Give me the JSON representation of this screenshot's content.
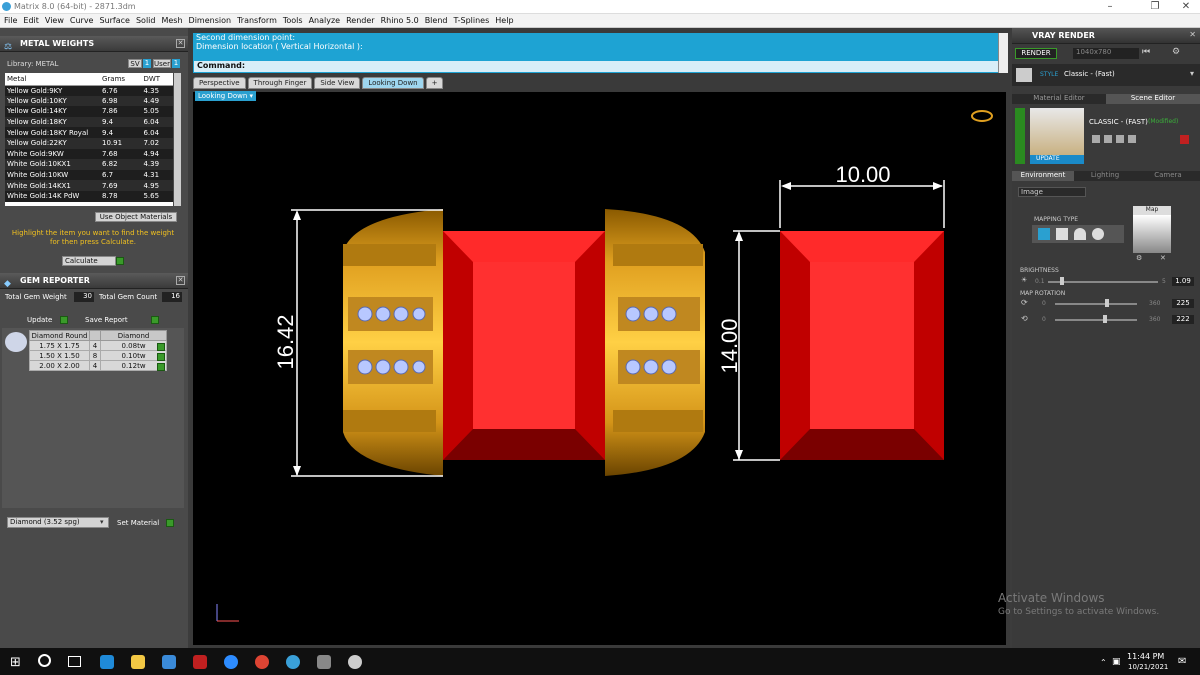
{
  "window": {
    "title": "Matrix 8.0 (64-bit) - 2871.3dm"
  },
  "menu": [
    "File",
    "Edit",
    "View",
    "Curve",
    "Surface",
    "Solid",
    "Mesh",
    "Dimension",
    "Transform",
    "Tools",
    "Analyze",
    "Render",
    "Rhino 5.0",
    "Blend",
    "T-Splines",
    "Help"
  ],
  "metal_weights": {
    "title": "METAL WEIGHTS",
    "library_label": "Library: METAL",
    "sv_label": "SV",
    "user_label": "User",
    "sv_count": "1",
    "user_count": "1",
    "columns": [
      "Metal",
      "Grams",
      "DWT"
    ],
    "rows": [
      [
        "Yellow Gold:9KY",
        "6.76",
        "4.35"
      ],
      [
        "Yellow Gold:10KY",
        "6.98",
        "4.49"
      ],
      [
        "Yellow Gold:14KY",
        "7.86",
        "5.05"
      ],
      [
        "Yellow Gold:18KY",
        "9.4",
        "6.04"
      ],
      [
        "Yellow Gold:18KY Royal",
        "9.4",
        "6.04"
      ],
      [
        "Yellow Gold:22KY",
        "10.91",
        "7.02"
      ],
      [
        "White Gold:9KW",
        "7.68",
        "4.94"
      ],
      [
        "White Gold:10KX1",
        "6.82",
        "4.39"
      ],
      [
        "White Gold:10KW",
        "6.7",
        "4.31"
      ],
      [
        "White Gold:14KX1",
        "7.69",
        "4.95"
      ],
      [
        "White Gold:14K PdW",
        "8.78",
        "5.65"
      ]
    ],
    "use_object_materials": "Use Object Materials",
    "hint": "Highlight the item you want to find the weight for then press Calculate.",
    "calculate": "Calculate"
  },
  "gem_reporter": {
    "title": "GEM REPORTER",
    "total_weight_label": "Total Gem Weight",
    "total_weight": "30",
    "total_count_label": "Total Gem Count",
    "total_count": "16",
    "update": "Update",
    "save_report": "Save Report",
    "columns": [
      "Diamond Round",
      "",
      "Diamond"
    ],
    "rows": [
      [
        "1.75 X 1.75",
        "4",
        "0.08tw"
      ],
      [
        "1.50 X 1.50",
        "8",
        "0.10tw"
      ],
      [
        "2.00 X 2.00",
        "4",
        "0.12tw"
      ]
    ],
    "material": "Diamond      (3.52 spg)",
    "set_material": "Set Material"
  },
  "command": {
    "line1": "Second dimension point:",
    "line2": "Dimension location ( Vertical  Horizontal ):",
    "label": "Command:"
  },
  "tabs": [
    "Perspective",
    "Through Finger",
    "Side View",
    "Looking Down"
  ],
  "active_view": "Looking Down",
  "dimensions": {
    "height_left": "16.42",
    "width_top": "10.00",
    "height_right": "14.00"
  },
  "vray": {
    "title": "VRAY RENDER",
    "render": "RENDER",
    "resolution": "1040x780",
    "preset_label": "STYLE",
    "preset": "Classic - (Fast)",
    "tab_material": "Material Editor",
    "tab_scene": "Scene Editor",
    "scene_name": "CLASSIC - (FAST)",
    "modified": "(Modified)",
    "update": "UPDATE",
    "env_tabs": [
      "Environment",
      "Lighting",
      "Camera"
    ],
    "env_select": "Image",
    "mapping_type": "MAPPING TYPE",
    "map_label": "Map",
    "brightness": "BRIGHTNESS",
    "br_min": "0.1",
    "br_max": "5",
    "br_val": "1.09",
    "map_rotation": "MAP ROTATION",
    "rot1_min": "0",
    "rot1_max": "360",
    "rot1_val": "225",
    "rot2_min": "0",
    "rot2_max": "360",
    "rot2_val": "222"
  },
  "watermark": {
    "line1": "Activate Windows",
    "line2": "Go to Settings to activate Windows."
  },
  "taskbar": {
    "time": "11:44 PM",
    "date": "10/21/2021"
  }
}
